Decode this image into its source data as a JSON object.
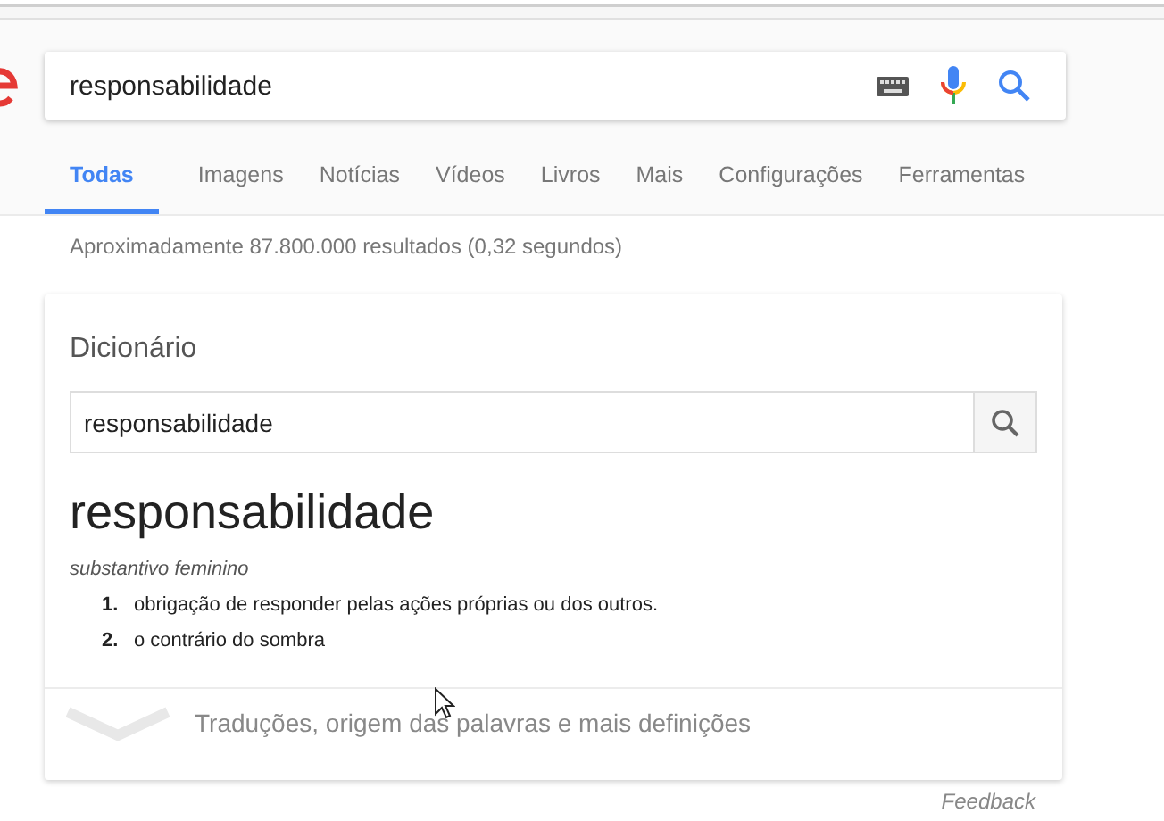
{
  "search": {
    "value": "responsabilidade"
  },
  "tabs": [
    {
      "label": "Todas",
      "selected": true
    },
    {
      "label": "Imagens",
      "selected": false
    },
    {
      "label": "Notícias",
      "selected": false
    },
    {
      "label": "Vídeos",
      "selected": false
    },
    {
      "label": "Livros",
      "selected": false
    },
    {
      "label": "Mais",
      "selected": false
    },
    {
      "label": "Configurações",
      "selected": false
    },
    {
      "label": "Ferramentas",
      "selected": false
    }
  ],
  "result_stats": "Aproximadamente 87.800.000 resultados (0,32 segundos)",
  "dictionary": {
    "title": "Dicionário",
    "search_value": "responsabilidade",
    "word": "responsabilidade",
    "part_of_speech": "substantivo feminino",
    "definitions": [
      {
        "number": "1.",
        "text": "obrigação de responder pelas ações próprias ou dos outros."
      },
      {
        "number": "2.",
        "text": "o contrário do sombra"
      }
    ],
    "more_link": "Traduções, origem das palavras e mais definições"
  },
  "feedback": "Feedback"
}
